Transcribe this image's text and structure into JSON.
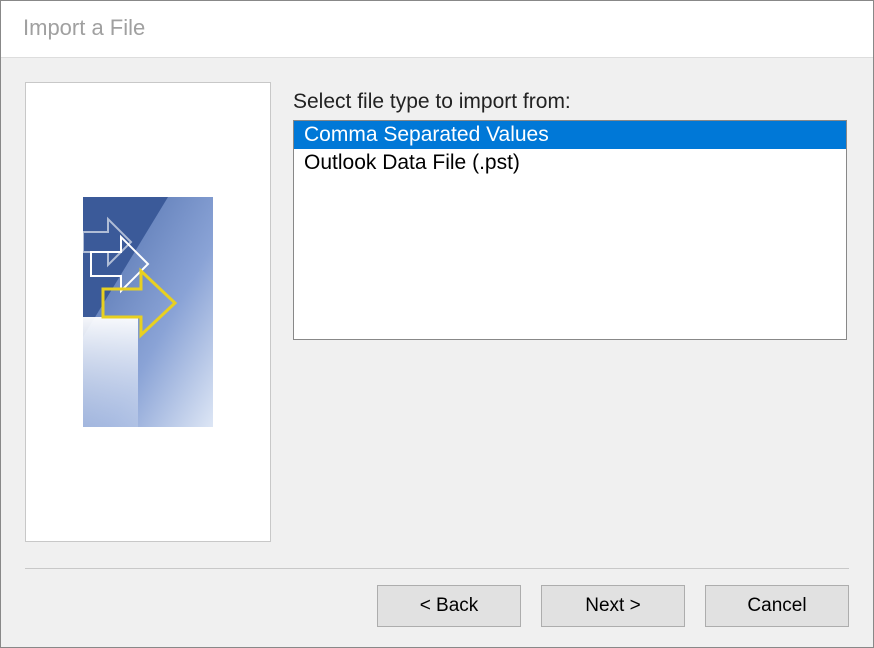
{
  "window": {
    "title": "Import a File"
  },
  "prompt": "Select file type to import from:",
  "fileTypes": [
    {
      "label": "Comma Separated Values",
      "selected": true
    },
    {
      "label": "Outlook Data File (.pst)",
      "selected": false
    }
  ],
  "buttons": {
    "back": "< Back",
    "next": "Next >",
    "cancel": "Cancel"
  }
}
